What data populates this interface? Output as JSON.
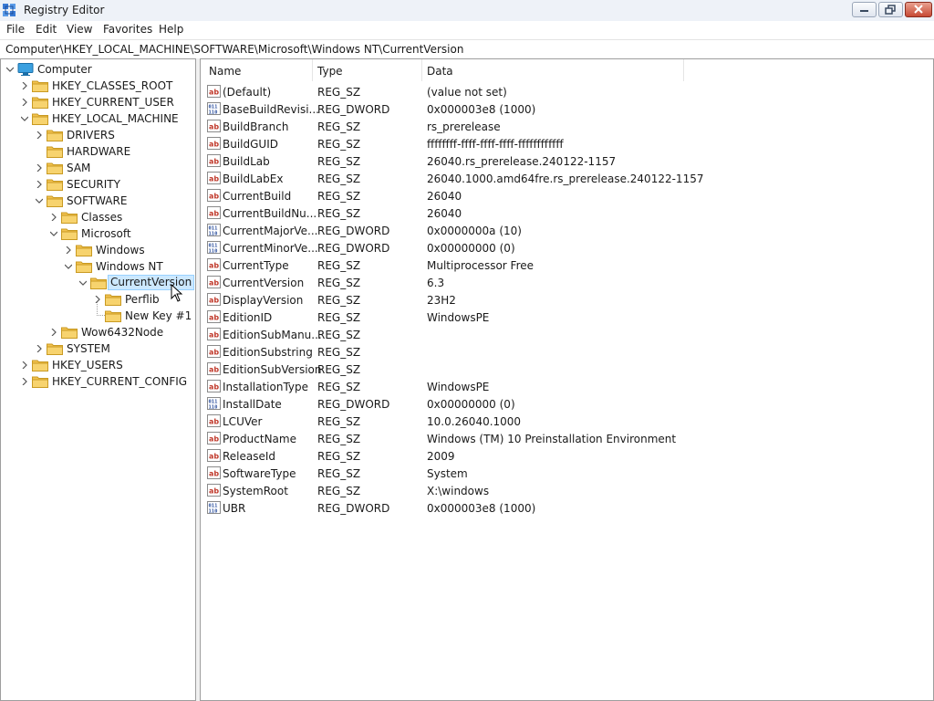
{
  "window": {
    "title": "Registry Editor",
    "icon": "registry-editor-icon"
  },
  "menu": [
    "File",
    "Edit",
    "View",
    "Favorites",
    "Help"
  ],
  "address": "Computer\\HKEY_LOCAL_MACHINE\\SOFTWARE\\Microsoft\\Windows NT\\CurrentVersion",
  "tree": [
    {
      "label": "Computer",
      "level": 0,
      "expander": "expanded",
      "icon": "computer-icon"
    },
    {
      "label": "HKEY_CLASSES_ROOT",
      "level": 1,
      "expander": "collapsed",
      "icon": "folder-icon"
    },
    {
      "label": "HKEY_CURRENT_USER",
      "level": 1,
      "expander": "collapsed",
      "icon": "folder-icon"
    },
    {
      "label": "HKEY_LOCAL_MACHINE",
      "level": 1,
      "expander": "expanded",
      "icon": "folder-icon"
    },
    {
      "label": "DRIVERS",
      "level": 2,
      "expander": "collapsed",
      "icon": "folder-icon"
    },
    {
      "label": "HARDWARE",
      "level": 2,
      "expander": "none",
      "icon": "folder-icon"
    },
    {
      "label": "SAM",
      "level": 2,
      "expander": "collapsed",
      "icon": "folder-icon"
    },
    {
      "label": "SECURITY",
      "level": 2,
      "expander": "collapsed",
      "icon": "folder-icon"
    },
    {
      "label": "SOFTWARE",
      "level": 2,
      "expander": "expanded",
      "icon": "folder-icon"
    },
    {
      "label": "Classes",
      "level": 3,
      "expander": "collapsed",
      "icon": "folder-icon"
    },
    {
      "label": "Microsoft",
      "level": 3,
      "expander": "expanded",
      "icon": "folder-icon"
    },
    {
      "label": "Windows",
      "level": 4,
      "expander": "collapsed",
      "icon": "folder-icon"
    },
    {
      "label": "Windows NT",
      "level": 4,
      "expander": "expanded",
      "icon": "folder-icon"
    },
    {
      "label": "CurrentVersion",
      "level": 5,
      "expander": "expanded",
      "icon": "folder-icon",
      "selected": true
    },
    {
      "label": "Perflib",
      "level": 6,
      "expander": "collapsed",
      "icon": "folder-icon"
    },
    {
      "label": "New Key #1",
      "level": 6,
      "expander": "none",
      "icon": "folder-icon"
    },
    {
      "label": "Wow6432Node",
      "level": 3,
      "expander": "collapsed",
      "icon": "folder-icon"
    },
    {
      "label": "SYSTEM",
      "level": 2,
      "expander": "collapsed",
      "icon": "folder-icon"
    },
    {
      "label": "HKEY_USERS",
      "level": 1,
      "expander": "collapsed",
      "icon": "folder-icon"
    },
    {
      "label": "HKEY_CURRENT_CONFIG",
      "level": 1,
      "expander": "collapsed",
      "icon": "folder-icon"
    }
  ],
  "columns": {
    "name": "Name",
    "type": "Type",
    "data": "Data"
  },
  "values": [
    {
      "name": "(Default)",
      "type": "REG_SZ",
      "data": "(value not set)",
      "icon": "string-value-icon"
    },
    {
      "name": "BaseBuildRevisi...",
      "type": "REG_DWORD",
      "data": "0x000003e8 (1000)",
      "icon": "binary-value-icon"
    },
    {
      "name": "BuildBranch",
      "type": "REG_SZ",
      "data": "rs_prerelease",
      "icon": "string-value-icon"
    },
    {
      "name": "BuildGUID",
      "type": "REG_SZ",
      "data": "ffffffff-ffff-ffff-ffff-ffffffffffff",
      "icon": "string-value-icon"
    },
    {
      "name": "BuildLab",
      "type": "REG_SZ",
      "data": "26040.rs_prerelease.240122-1157",
      "icon": "string-value-icon"
    },
    {
      "name": "BuildLabEx",
      "type": "REG_SZ",
      "data": "26040.1000.amd64fre.rs_prerelease.240122-1157",
      "icon": "string-value-icon"
    },
    {
      "name": "CurrentBuild",
      "type": "REG_SZ",
      "data": "26040",
      "icon": "string-value-icon"
    },
    {
      "name": "CurrentBuildNu...",
      "type": "REG_SZ",
      "data": "26040",
      "icon": "string-value-icon"
    },
    {
      "name": "CurrentMajorVe...",
      "type": "REG_DWORD",
      "data": "0x0000000a (10)",
      "icon": "binary-value-icon"
    },
    {
      "name": "CurrentMinorVe...",
      "type": "REG_DWORD",
      "data": "0x00000000 (0)",
      "icon": "binary-value-icon"
    },
    {
      "name": "CurrentType",
      "type": "REG_SZ",
      "data": "Multiprocessor Free",
      "icon": "string-value-icon"
    },
    {
      "name": "CurrentVersion",
      "type": "REG_SZ",
      "data": "6.3",
      "icon": "string-value-icon"
    },
    {
      "name": "DisplayVersion",
      "type": "REG_SZ",
      "data": "23H2",
      "icon": "string-value-icon"
    },
    {
      "name": "EditionID",
      "type": "REG_SZ",
      "data": "WindowsPE",
      "icon": "string-value-icon"
    },
    {
      "name": "EditionSubManu...",
      "type": "REG_SZ",
      "data": "",
      "icon": "string-value-icon"
    },
    {
      "name": "EditionSubstring",
      "type": "REG_SZ",
      "data": "",
      "icon": "string-value-icon"
    },
    {
      "name": "EditionSubVersion",
      "type": "REG_SZ",
      "data": "",
      "icon": "string-value-icon"
    },
    {
      "name": "InstallationType",
      "type": "REG_SZ",
      "data": "WindowsPE",
      "icon": "string-value-icon"
    },
    {
      "name": "InstallDate",
      "type": "REG_DWORD",
      "data": "0x00000000 (0)",
      "icon": "binary-value-icon"
    },
    {
      "name": "LCUVer",
      "type": "REG_SZ",
      "data": "10.0.26040.1000",
      "icon": "string-value-icon"
    },
    {
      "name": "ProductName",
      "type": "REG_SZ",
      "data": "Windows (TM) 10 Preinstallation Environment",
      "icon": "string-value-icon"
    },
    {
      "name": "ReleaseId",
      "type": "REG_SZ",
      "data": "2009",
      "icon": "string-value-icon"
    },
    {
      "name": "SoftwareType",
      "type": "REG_SZ",
      "data": "System",
      "icon": "string-value-icon"
    },
    {
      "name": "SystemRoot",
      "type": "REG_SZ",
      "data": "X:\\windows",
      "icon": "string-value-icon"
    },
    {
      "name": "UBR",
      "type": "REG_DWORD",
      "data": "0x000003e8 (1000)",
      "icon": "binary-value-icon"
    }
  ],
  "colors": {
    "selection": "#cce8ff",
    "selection_border": "#99d1ff",
    "folder": "#f2c24f",
    "string_icon": "#c0392b",
    "binary_icon": "#2b4f9e",
    "close_button": "#c74a34"
  },
  "window_buttons": [
    "minimize-icon",
    "restore-icon",
    "close-icon"
  ],
  "cursor": "mouse-pointer-icon"
}
